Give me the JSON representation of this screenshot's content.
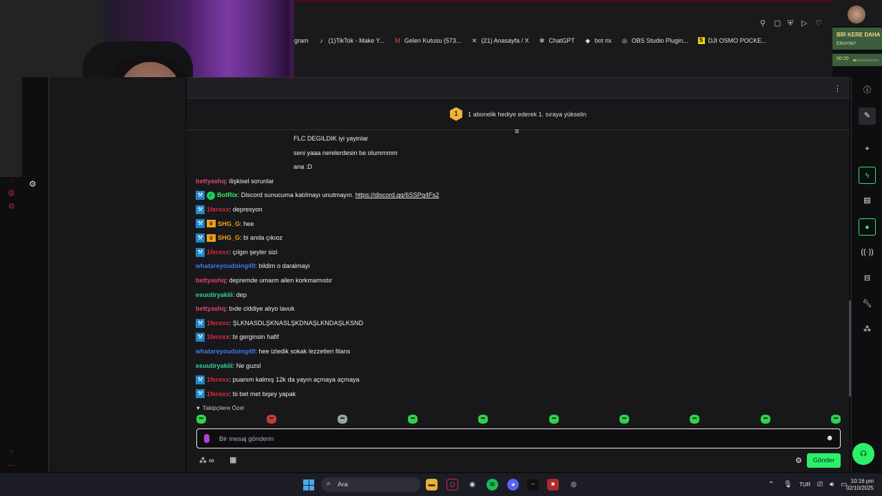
{
  "bookmarks": [
    {
      "label": "gram",
      "icon": "instagram-icon"
    },
    {
      "label": "(1)TikTok - Make Y...",
      "icon": "tiktok-icon"
    },
    {
      "label": "Gelen Kutusu (573...",
      "icon": "gmail-icon"
    },
    {
      "label": "(21) Anasayfa / X",
      "icon": "x-icon"
    },
    {
      "label": "ChatGPT",
      "icon": "chatgpt-icon"
    },
    {
      "label": "bot rix",
      "icon": "botrix-icon"
    },
    {
      "label": "OBS Studio Plugin...",
      "icon": "obs-icon"
    },
    {
      "label": "DJI OSMO POCKE...",
      "icon": "dji-icon"
    }
  ],
  "alert": {
    "title": "BİR KERE DAHA",
    "user": "ERAY067",
    "timer": "00:20",
    "progress": 0.1
  },
  "chat": {
    "banner": "1 abonelik hediye ederek 1. sıraya yükselin",
    "rank": "1",
    "messages": [
      {
        "user": "",
        "color": "#efeff1",
        "text": "FLC DEGILDIK iyi yayinlar",
        "badges": []
      },
      {
        "user": "",
        "color": "#efeff1",
        "text": "seni yaaa nerelerdesin be olummmm",
        "badges": []
      },
      {
        "user": "",
        "color": "#efeff1",
        "text": "ana :D",
        "badges": []
      },
      {
        "user": "bettyashq",
        "color": "#e0466a",
        "text": "ilişkisel sorunlar",
        "badges": []
      },
      {
        "user": "BotRix",
        "color": "#2cf06a",
        "text": "Discord sunucuma katılmayı unutmayın. ",
        "link": "https://discord.gg/6SSPg4Fs2",
        "badges": [
          "mod",
          "verified"
        ]
      },
      {
        "user": "1feroxx",
        "color": "#e0283c",
        "text": "depresyon",
        "badges": [
          "mod"
        ]
      },
      {
        "user": "SHG_G",
        "color": "#f0a11a",
        "text": "hee",
        "badges": [
          "mod",
          "crown"
        ]
      },
      {
        "user": "SHG_G",
        "color": "#f0a11a",
        "text": "bi anda çıkıoz",
        "badges": [
          "mod",
          "crown"
        ]
      },
      {
        "user": "1feroxx",
        "color": "#e0283c",
        "text": "çılgın şeyler sizi",
        "badges": [
          "mod"
        ]
      },
      {
        "user": "whatareyoudoing49",
        "color": "#3b7be8",
        "text": "bildim o daralmayi",
        "badges": []
      },
      {
        "user": "bettyashq",
        "color": "#e0466a",
        "text": "depremde umaım ailen korkmamıstır",
        "badges": []
      },
      {
        "user": "esuutiryakiii",
        "color": "#2fd39a",
        "text": "dep",
        "badges": []
      },
      {
        "user": "bettyashq",
        "color": "#e0466a",
        "text": "bıde ciddiye alıyo lavuk",
        "badges": []
      },
      {
        "user": "1feroxx",
        "color": "#e0283c",
        "text": "ŞLKNASDLŞKNASLŞKDNAŞLKNDAŞLKSND",
        "badges": [
          "mod"
        ]
      },
      {
        "user": "1feroxx",
        "color": "#e0283c",
        "text": "bi gerginsin hafif",
        "badges": [
          "mod"
        ]
      },
      {
        "user": "whatareyoudoing49",
        "color": "#3b7be8",
        "text": "hee izledik sokak lezzetleri filans",
        "badges": []
      },
      {
        "user": "esuutiryakiii",
        "color": "#2fd39a",
        "text": "Ne guzsl",
        "badges": []
      },
      {
        "user": "1feroxx",
        "color": "#e0283c",
        "text": "puanım kalmış 12k da yayın açmaya açmaya",
        "badges": [
          "mod"
        ]
      },
      {
        "user": "1feroxx",
        "color": "#e0283c",
        "text": "bi bet met bişey yapak",
        "badges": [
          "mod"
        ]
      }
    ],
    "followers_only": "Takipçilere Özel",
    "input_placeholder": "Bir mesaj gönderin",
    "send_label": "Gönder"
  },
  "taskbar": {
    "search_label": "Ara",
    "language": "TUR",
    "time": "10:16 pm",
    "date": "02/10/2025"
  }
}
